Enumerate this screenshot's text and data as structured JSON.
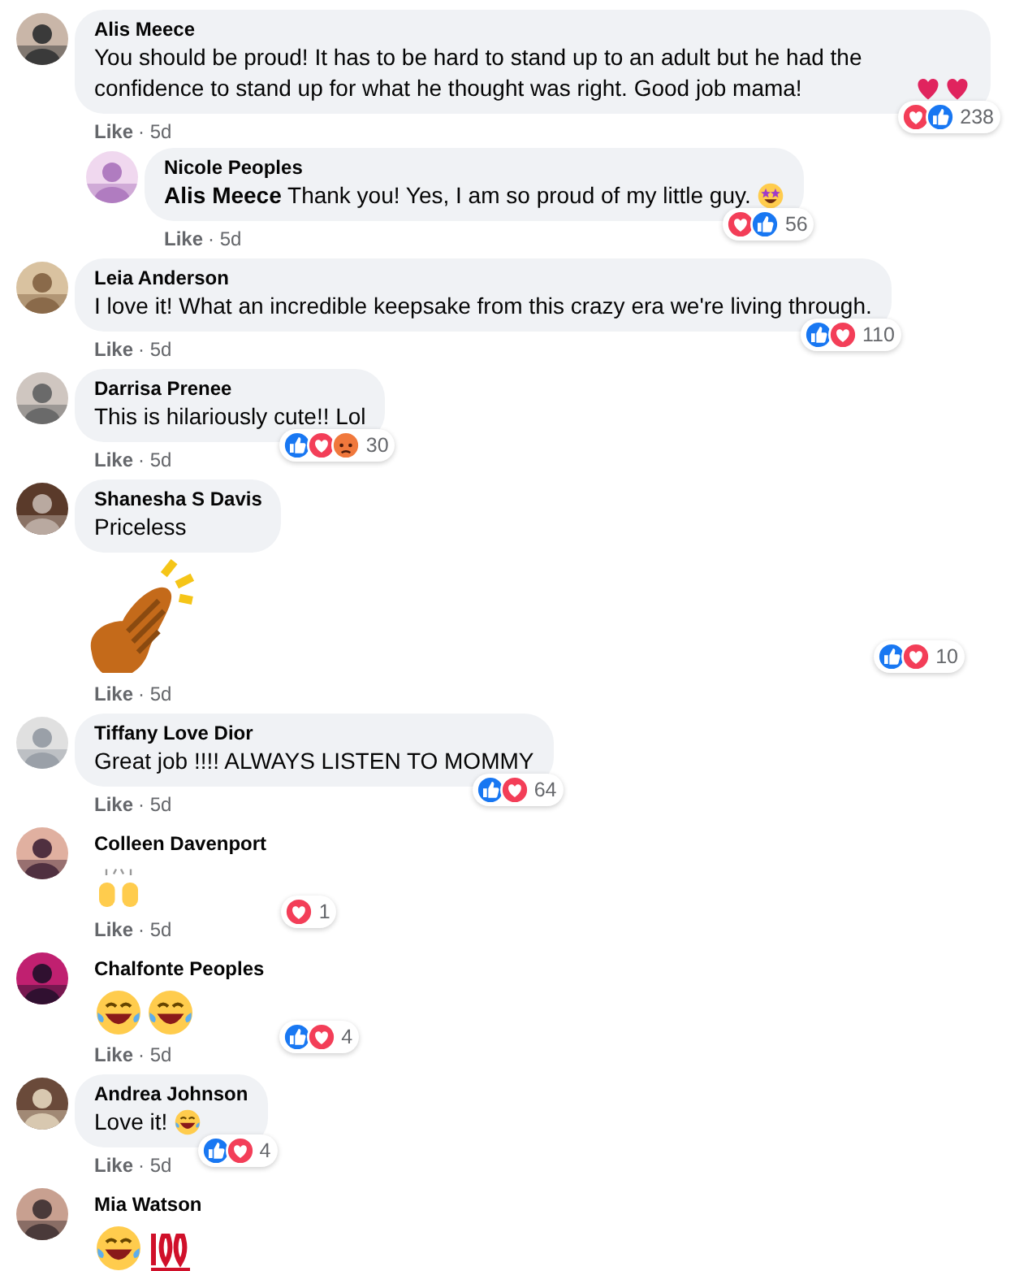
{
  "comments": [
    {
      "author": "Alis Meece",
      "text": "You should be proud! It has to be hard to stand up to an adult but he had the confidence to stand up for what he thought was right. Good job mama!",
      "emojis": [
        {
          "kind": "heart"
        },
        {
          "kind": "heart"
        }
      ],
      "reactions": [
        {
          "kind": "love"
        },
        {
          "kind": "like"
        }
      ],
      "count": "238",
      "like": "Like",
      "time": "· 5d",
      "replies": [
        {
          "author": "Nicole Peoples",
          "text": "**Alis Meece** Thank you! Yes, I am so proud of my little guy.",
          "emojis": [
            {
              "kind": "starstruck"
            }
          ],
          "reactions": [
            {
              "kind": "love"
            },
            {
              "kind": "like"
            }
          ],
          "count": "56",
          "like": "Like",
          "time": "· 5d"
        }
      ]
    },
    {
      "author": "Leia Anderson",
      "text": "I love it! What an incredible keepsake from this crazy era we're living through.",
      "reactions": [
        {
          "kind": "like"
        },
        {
          "kind": "love"
        }
      ],
      "count": "110",
      "like": "Like",
      "time": "· 5d"
    },
    {
      "author": "Darrisa Prenee",
      "text": "This is hilariously cute!! Lol",
      "reactions": [
        {
          "kind": "like"
        },
        {
          "kind": "love"
        },
        {
          "kind": "angry"
        }
      ],
      "count": "30",
      "like": "Like",
      "time": "· 5d"
    },
    {
      "author": "Shanesha S Davis",
      "text": "Priceless",
      "sticker": {
        "kind": "clap"
      },
      "reactions": [
        {
          "kind": "like"
        },
        {
          "kind": "love"
        }
      ],
      "count": "10",
      "like": "Like",
      "time": "· 5d"
    },
    {
      "author": "Tiffany Love Dior",
      "text": "Great job !!!! ALWAYS LISTEN TO MOMMY",
      "reactions": [
        {
          "kind": "like"
        },
        {
          "kind": "love"
        }
      ],
      "count": "64",
      "like": "Like",
      "time": "· 5d"
    },
    {
      "author": "Colleen Davenport",
      "emojis": [
        {
          "kind": "raised"
        }
      ],
      "reactions": [
        {
          "kind": "love"
        }
      ],
      "count": "1",
      "like": "Like",
      "time": "· 5d"
    },
    {
      "author": "Chalfonte Peoples",
      "emojis": [
        {
          "kind": "haha"
        },
        {
          "kind": "haha"
        }
      ],
      "reactions": [
        {
          "kind": "like"
        },
        {
          "kind": "love"
        }
      ],
      "count": "4",
      "like": "Like",
      "time": "· 5d"
    },
    {
      "author": "Andrea Johnson",
      "text": "Love it!",
      "emojis": [
        {
          "kind": "haha"
        }
      ],
      "reactions": [
        {
          "kind": "like"
        },
        {
          "kind": "love"
        }
      ],
      "count": "4",
      "like": "Like",
      "time": "· 5d"
    },
    {
      "author": "Mia Watson",
      "emojis": [
        {
          "kind": "haha"
        },
        {
          "kind": "hundred"
        }
      ]
    }
  ]
}
